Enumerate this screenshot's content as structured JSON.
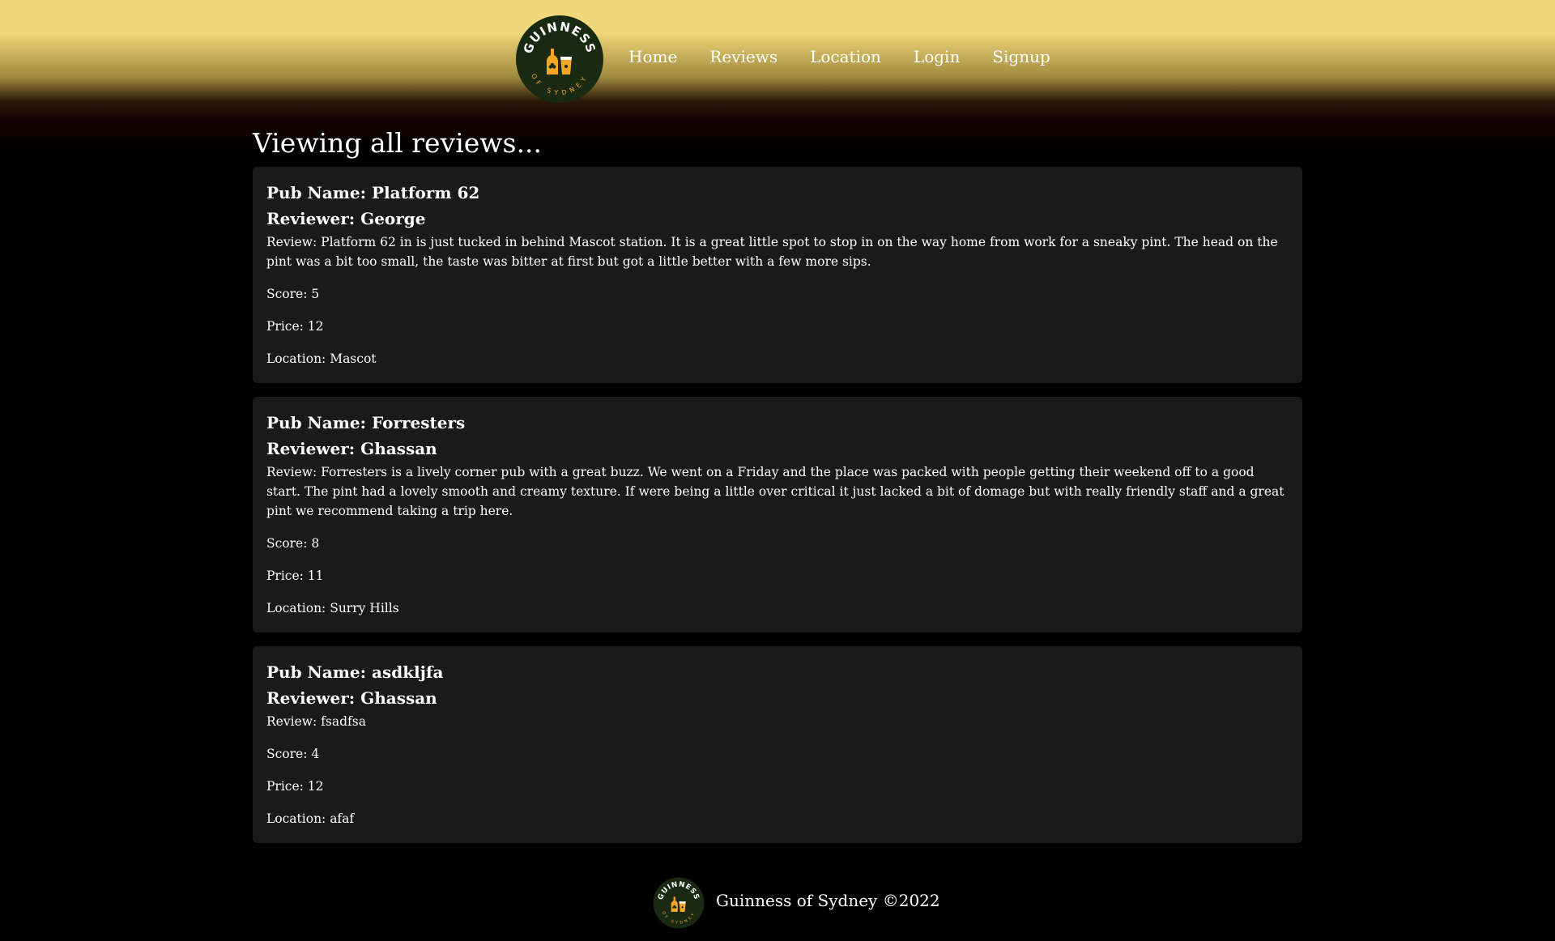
{
  "brand": {
    "logo_top_text": "GUINNESS",
    "logo_bottom_text": "OF SYDNEY",
    "accent_color": "#f5a623",
    "logo_bg": "#1a2a12"
  },
  "nav": {
    "items": [
      {
        "label": "Home"
      },
      {
        "label": "Reviews"
      },
      {
        "label": "Location"
      },
      {
        "label": "Login"
      },
      {
        "label": "Signup"
      }
    ]
  },
  "main": {
    "title": "Viewing all reviews...",
    "reviews": [
      {
        "pub_name": "Pub Name: Platform 62",
        "reviewer": "Reviewer: George",
        "review": "Review: Platform 62 in is just tucked in behind Mascot station. It is a great little spot to stop in on the way home from work for a sneaky pint. The head on the pint was a bit too small, the taste was bitter at first but got a little better with a few more sips.",
        "score": "Score: 5",
        "price": "Price: 12",
        "location": "Location: Mascot"
      },
      {
        "pub_name": "Pub Name: Forresters",
        "reviewer": "Reviewer: Ghassan",
        "review": "Review: Forresters is a lively corner pub with a great buzz. We went on a Friday and the place was packed with people getting their weekend off to a good start. The pint had a lovely smooth and creamy texture. If were being a little over critical it just lacked a bit of domage but with really friendly staff and a great pint we recommend taking a trip here.",
        "score": "Score: 8",
        "price": "Price: 11",
        "location": "Location: Surry Hills"
      },
      {
        "pub_name": "Pub Name: asdkljfa",
        "reviewer": "Reviewer: Ghassan",
        "review": "Review: fsadfsa",
        "score": "Score: 4",
        "price": "Price: 12",
        "location": "Location: afaf"
      }
    ]
  },
  "footer": {
    "text": "Guinness of Sydney ©2022"
  }
}
